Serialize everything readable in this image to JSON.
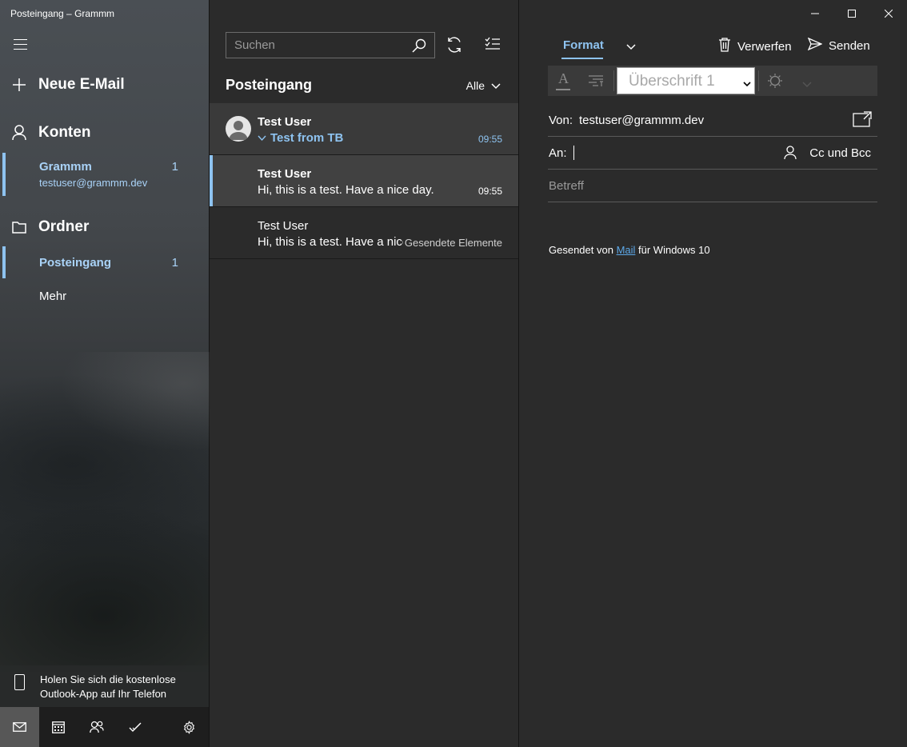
{
  "window": {
    "title": "Posteingang – Grammm"
  },
  "sidebar": {
    "menu_icon": "hamburger-icon",
    "new_mail": "Neue E-Mail",
    "accounts_label": "Konten",
    "account": {
      "name": "Grammm",
      "email": "testuser@grammm.dev",
      "count": "1"
    },
    "folders_label": "Ordner",
    "folder_selected": {
      "name": "Posteingang",
      "count": "1"
    },
    "more": "Mehr",
    "promo": "Holen Sie sich die kostenlose Outlook-App auf Ihr Telefon",
    "bottom_nav": [
      "mail-icon",
      "calendar-icon",
      "people-icon",
      "todo-icon",
      "settings-icon"
    ]
  },
  "list": {
    "search_placeholder": "Suchen",
    "title": "Posteingang",
    "filter": "Alle",
    "messages": [
      {
        "from": "Test User",
        "subject": "Test from TB",
        "time": "09:55"
      },
      {
        "from": "Test User",
        "preview": "Hi, this is a test. Have a nice day.",
        "time": "09:55"
      },
      {
        "from": "Test User",
        "preview": "Hi, this is a test. Have a nice",
        "folder": "Gesendete Elemente"
      }
    ]
  },
  "compose": {
    "tab_format": "Format",
    "discard": "Verwerfen",
    "send": "Senden",
    "heading_style": "Überschrift 1",
    "from_label": "Von:",
    "from_value": "testuser@grammm.dev",
    "to_label": "An:",
    "cc_bcc": "Cc und Bcc",
    "subject_placeholder": "Betreff",
    "signature_prefix": "Gesendet von ",
    "signature_link": "Mail",
    "signature_suffix": " für Windows 10"
  },
  "colors": {
    "accent": "#8ec3f0",
    "link": "#5ca8e8",
    "pane_bg": "#2b2b2b"
  }
}
